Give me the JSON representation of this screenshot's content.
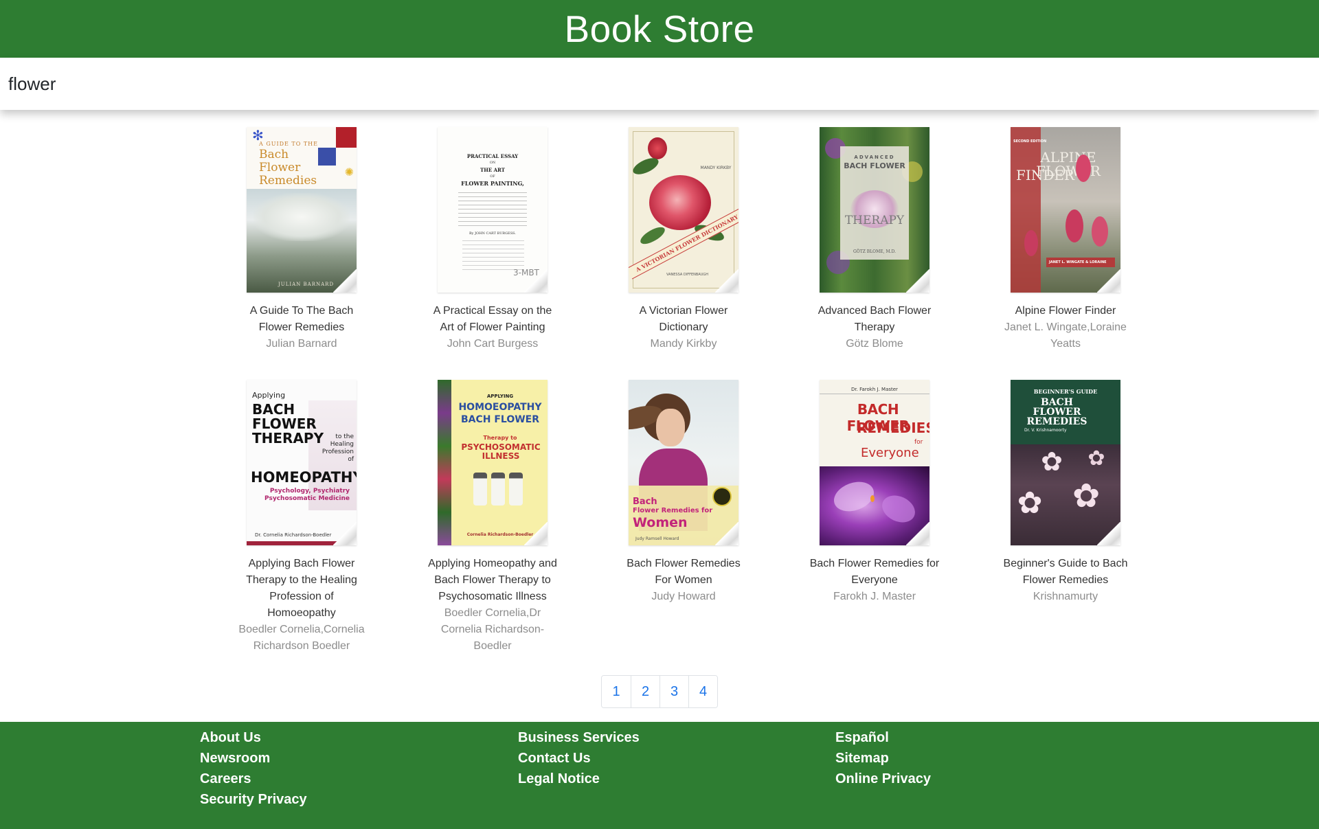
{
  "header": {
    "title": "Book Store"
  },
  "search": {
    "value": "flower"
  },
  "books": [
    {
      "title": "A Guide To The Bach Flower Remedies",
      "author": "Julian Barnard"
    },
    {
      "title": "A Practical Essay on the Art of Flower Painting",
      "author": "John Cart Burgess"
    },
    {
      "title": "A Victorian Flower Dictionary",
      "author": "Mandy Kirkby"
    },
    {
      "title": "Advanced Bach Flower Therapy",
      "author": "Götz Blome"
    },
    {
      "title": "Alpine Flower Finder",
      "author": "Janet L. Wingate,Loraine Yeatts"
    },
    {
      "title": "Applying Bach Flower Therapy to the Healing Profession of Homoeopathy",
      "author": "Boedler Cornelia,Cornelia Richardson Boedler"
    },
    {
      "title": "Applying Homeopathy and Bach Flower Therapy to Psychosomatic Illness",
      "author": "Boedler Cornelia,Dr Cornelia Richardson-Boedler"
    },
    {
      "title": "Bach Flower Remedies For Women",
      "author": "Judy Howard"
    },
    {
      "title": "Bach Flower Remedies for Everyone",
      "author": "Farokh J. Master"
    },
    {
      "title": "Beginner's Guide to Bach Flower Remedies",
      "author": "Krishnamurty"
    }
  ],
  "covers": {
    "c1": {
      "line1": "A GUIDE TO THE",
      "line2": "Bach",
      "line3": "Flower",
      "line4": "Remedies",
      "author": "JULIAN BARNARD"
    },
    "c2": {
      "line1": "PRACTICAL ESSAY",
      "line2": "ON",
      "line3": "THE ART",
      "line4": "OF",
      "line5": "FLOWER PAINTING,",
      "author": "By JOHN CART BURGESS."
    },
    "c3": {
      "author": "MANDY KIRKBY",
      "band": "A VICTORIAN FLOWER DICTIONARY",
      "sub": "VANESSA DIFFENBAUGH"
    },
    "c4": {
      "line1": "ADVANCED",
      "line2": "BACH FLOWER",
      "line3": "THERAPY",
      "author": "GÖTZ BLOME, M.D."
    },
    "c5": {
      "edition": "SECOND EDITION",
      "line1": "ALPINE FLOWER",
      "line2": "FINDER",
      "author": "JANET L. WINGATE & LORAINE"
    },
    "c6": {
      "line1": "Applying",
      "line2": "BACH",
      "line3": "FLOWER",
      "line4": "THERAPY",
      "line5": "to the Healing Profession of",
      "line6": "HOMEOPATHY",
      "line7": "Psychology, Psychiatry Psychosomatic Medicine",
      "author": "Dr. Cornelia Richardson-Boedler"
    },
    "c7": {
      "line1": "APPLYING",
      "line2": "HOMOEOPATHY",
      "line3": "BACH FLOWER",
      "line4": "Therapy to",
      "line5": "PSYCHOSOMATIC ILLNESS",
      "author": "Cornelia Richardson-Boedler"
    },
    "c8": {
      "line1": "Bach",
      "line2": "Flower Remedies for",
      "line3": "Women",
      "author": "Judy Ramsell Howard"
    },
    "c9": {
      "author": "Dr. Farokh J. Master",
      "line1": "BACH FLOWER",
      "line2": "REMEDIES",
      "line3": "for",
      "line4": "Everyone"
    },
    "c10": {
      "line1": "BEGINNER'S GUIDE",
      "line2": "BACH FLOWER REMEDIES",
      "author": "Dr. V. Krishnamoorty"
    }
  },
  "pagination": {
    "pages": [
      "1",
      "2",
      "3",
      "4"
    ]
  },
  "footer": {
    "col1": [
      "About Us",
      "Newsroom",
      "Careers",
      "Security Privacy"
    ],
    "col2": [
      "Business Services",
      "Contact Us",
      "Legal Notice"
    ],
    "col3": [
      "Español",
      "Sitemap",
      "Online Privacy"
    ]
  },
  "colors": {
    "brand_green": "#2e7d32",
    "link_blue": "#1a73e8",
    "muted_text": "#8c8c8c"
  }
}
